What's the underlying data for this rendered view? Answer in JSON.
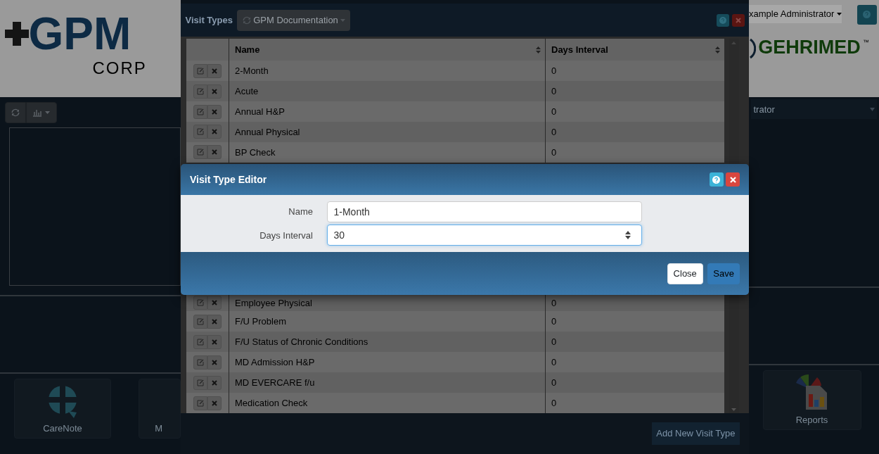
{
  "app": {
    "logo_left": {
      "mark": "GPM",
      "sub": "CORP"
    },
    "user_menu": "xample Administrator",
    "logo_right": {
      "name": "GEHRIMED",
      "tm": "™"
    },
    "role_select": "trator",
    "tiles": [
      {
        "label": "CareNote",
        "kind": "carenote"
      },
      {
        "label": "M",
        "kind": "partial"
      },
      {
        "label": "Reports",
        "kind": "reports"
      }
    ]
  },
  "visit_types_window": {
    "title": "Visit Types",
    "source_button": "GPM Documentation",
    "columns": [
      "Name",
      "Days Interval"
    ],
    "rows_above": [
      {
        "name": "2-Month",
        "days": "0"
      },
      {
        "name": "Acute",
        "days": "0"
      },
      {
        "name": "Annual H&P",
        "days": "0"
      },
      {
        "name": "Annual Physical",
        "days": "0"
      },
      {
        "name": "BP Check",
        "days": "0"
      }
    ],
    "rows_below": [
      {
        "name": "Employee Physical",
        "days": "0"
      },
      {
        "name": "F/U Problem",
        "days": "0"
      },
      {
        "name": "F/U Status of Chronic Conditions",
        "days": "0"
      },
      {
        "name": "MD Admission H&P",
        "days": "0"
      },
      {
        "name": "MD EVERCARE f/u",
        "days": "0"
      },
      {
        "name": "Medication Check",
        "days": "0"
      }
    ],
    "add_button": "Add New Visit Type"
  },
  "editor_dialog": {
    "title": "Visit Type Editor",
    "fields": [
      {
        "label": "Name",
        "value": "1-Month",
        "kind": "text"
      },
      {
        "label": "Days Interval",
        "value": "30",
        "kind": "number"
      }
    ],
    "buttons": [
      {
        "label": "Close",
        "kind": "default"
      },
      {
        "label": "Save",
        "kind": "primary"
      }
    ]
  }
}
